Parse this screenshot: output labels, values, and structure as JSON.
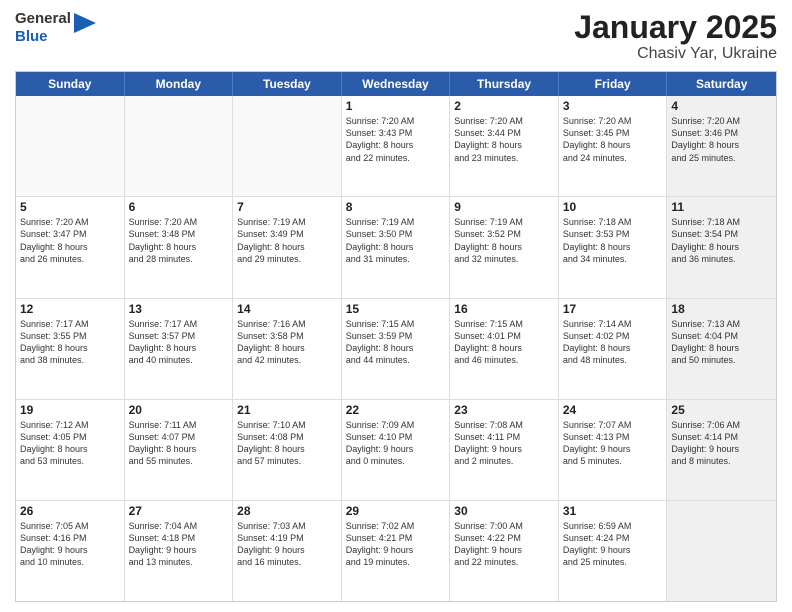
{
  "header": {
    "logo_line1": "General",
    "logo_line2": "Blue",
    "title": "January 2025",
    "subtitle": "Chasiv Yar, Ukraine"
  },
  "days_of_week": [
    "Sunday",
    "Monday",
    "Tuesday",
    "Wednesday",
    "Thursday",
    "Friday",
    "Saturday"
  ],
  "weeks": [
    [
      {
        "day": "",
        "text": "",
        "empty": true
      },
      {
        "day": "",
        "text": "",
        "empty": true
      },
      {
        "day": "",
        "text": "",
        "empty": true
      },
      {
        "day": "1",
        "text": "Sunrise: 7:20 AM\nSunset: 3:43 PM\nDaylight: 8 hours\nand 22 minutes.",
        "shaded": false
      },
      {
        "day": "2",
        "text": "Sunrise: 7:20 AM\nSunset: 3:44 PM\nDaylight: 8 hours\nand 23 minutes.",
        "shaded": false
      },
      {
        "day": "3",
        "text": "Sunrise: 7:20 AM\nSunset: 3:45 PM\nDaylight: 8 hours\nand 24 minutes.",
        "shaded": false
      },
      {
        "day": "4",
        "text": "Sunrise: 7:20 AM\nSunset: 3:46 PM\nDaylight: 8 hours\nand 25 minutes.",
        "shaded": true
      }
    ],
    [
      {
        "day": "5",
        "text": "Sunrise: 7:20 AM\nSunset: 3:47 PM\nDaylight: 8 hours\nand 26 minutes.",
        "shaded": false
      },
      {
        "day": "6",
        "text": "Sunrise: 7:20 AM\nSunset: 3:48 PM\nDaylight: 8 hours\nand 28 minutes.",
        "shaded": false
      },
      {
        "day": "7",
        "text": "Sunrise: 7:19 AM\nSunset: 3:49 PM\nDaylight: 8 hours\nand 29 minutes.",
        "shaded": false
      },
      {
        "day": "8",
        "text": "Sunrise: 7:19 AM\nSunset: 3:50 PM\nDaylight: 8 hours\nand 31 minutes.",
        "shaded": false
      },
      {
        "day": "9",
        "text": "Sunrise: 7:19 AM\nSunset: 3:52 PM\nDaylight: 8 hours\nand 32 minutes.",
        "shaded": false
      },
      {
        "day": "10",
        "text": "Sunrise: 7:18 AM\nSunset: 3:53 PM\nDaylight: 8 hours\nand 34 minutes.",
        "shaded": false
      },
      {
        "day": "11",
        "text": "Sunrise: 7:18 AM\nSunset: 3:54 PM\nDaylight: 8 hours\nand 36 minutes.",
        "shaded": true
      }
    ],
    [
      {
        "day": "12",
        "text": "Sunrise: 7:17 AM\nSunset: 3:55 PM\nDaylight: 8 hours\nand 38 minutes.",
        "shaded": false
      },
      {
        "day": "13",
        "text": "Sunrise: 7:17 AM\nSunset: 3:57 PM\nDaylight: 8 hours\nand 40 minutes.",
        "shaded": false
      },
      {
        "day": "14",
        "text": "Sunrise: 7:16 AM\nSunset: 3:58 PM\nDaylight: 8 hours\nand 42 minutes.",
        "shaded": false
      },
      {
        "day": "15",
        "text": "Sunrise: 7:15 AM\nSunset: 3:59 PM\nDaylight: 8 hours\nand 44 minutes.",
        "shaded": false
      },
      {
        "day": "16",
        "text": "Sunrise: 7:15 AM\nSunset: 4:01 PM\nDaylight: 8 hours\nand 46 minutes.",
        "shaded": false
      },
      {
        "day": "17",
        "text": "Sunrise: 7:14 AM\nSunset: 4:02 PM\nDaylight: 8 hours\nand 48 minutes.",
        "shaded": false
      },
      {
        "day": "18",
        "text": "Sunrise: 7:13 AM\nSunset: 4:04 PM\nDaylight: 8 hours\nand 50 minutes.",
        "shaded": true
      }
    ],
    [
      {
        "day": "19",
        "text": "Sunrise: 7:12 AM\nSunset: 4:05 PM\nDaylight: 8 hours\nand 53 minutes.",
        "shaded": false
      },
      {
        "day": "20",
        "text": "Sunrise: 7:11 AM\nSunset: 4:07 PM\nDaylight: 8 hours\nand 55 minutes.",
        "shaded": false
      },
      {
        "day": "21",
        "text": "Sunrise: 7:10 AM\nSunset: 4:08 PM\nDaylight: 8 hours\nand 57 minutes.",
        "shaded": false
      },
      {
        "day": "22",
        "text": "Sunrise: 7:09 AM\nSunset: 4:10 PM\nDaylight: 9 hours\nand 0 minutes.",
        "shaded": false
      },
      {
        "day": "23",
        "text": "Sunrise: 7:08 AM\nSunset: 4:11 PM\nDaylight: 9 hours\nand 2 minutes.",
        "shaded": false
      },
      {
        "day": "24",
        "text": "Sunrise: 7:07 AM\nSunset: 4:13 PM\nDaylight: 9 hours\nand 5 minutes.",
        "shaded": false
      },
      {
        "day": "25",
        "text": "Sunrise: 7:06 AM\nSunset: 4:14 PM\nDaylight: 9 hours\nand 8 minutes.",
        "shaded": true
      }
    ],
    [
      {
        "day": "26",
        "text": "Sunrise: 7:05 AM\nSunset: 4:16 PM\nDaylight: 9 hours\nand 10 minutes.",
        "shaded": false
      },
      {
        "day": "27",
        "text": "Sunrise: 7:04 AM\nSunset: 4:18 PM\nDaylight: 9 hours\nand 13 minutes.",
        "shaded": false
      },
      {
        "day": "28",
        "text": "Sunrise: 7:03 AM\nSunset: 4:19 PM\nDaylight: 9 hours\nand 16 minutes.",
        "shaded": false
      },
      {
        "day": "29",
        "text": "Sunrise: 7:02 AM\nSunset: 4:21 PM\nDaylight: 9 hours\nand 19 minutes.",
        "shaded": false
      },
      {
        "day": "30",
        "text": "Sunrise: 7:00 AM\nSunset: 4:22 PM\nDaylight: 9 hours\nand 22 minutes.",
        "shaded": false
      },
      {
        "day": "31",
        "text": "Sunrise: 6:59 AM\nSunset: 4:24 PM\nDaylight: 9 hours\nand 25 minutes.",
        "shaded": false
      },
      {
        "day": "",
        "text": "",
        "empty": true,
        "shaded": true
      }
    ]
  ]
}
